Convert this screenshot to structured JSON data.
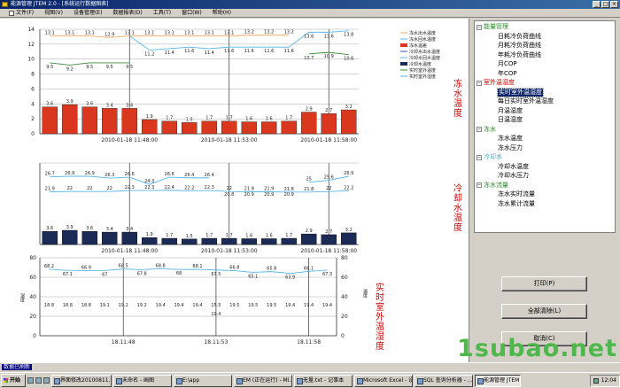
{
  "window": {
    "title": "能源管理 JTEM 2.0 - [系统运行数据图表]",
    "min": "_",
    "max": "□",
    "close": "×"
  },
  "menu": [
    "文件(F)",
    "视图(V)",
    "设备管理(E)",
    "数据报表(D)",
    "工具(T)",
    "窗口(W)",
    "帮助(H)"
  ],
  "colors": {
    "bar_red": "#d9381e",
    "bar_navy": "#1c2b55",
    "line_cyan": "#58b6e8",
    "line_orange": "#f0a860",
    "line_green": "#3a8a3a",
    "line_blue": "#3060b0",
    "side_red": "#cc0000",
    "side_green": "#2a8a2a",
    "side_cyan": "#40b0c0"
  },
  "chart_data": [
    {
      "type": "bar",
      "title": "冻水温度",
      "ylim": [
        0,
        14
      ],
      "yticks": [
        0,
        2,
        4,
        6,
        8,
        10,
        12,
        14
      ],
      "x_labels": [
        "2010-01-18 11:48:00",
        "2010-01-18 11:53:00",
        "2010-01-18 11:58:00"
      ],
      "values": [
        3.6,
        3.9,
        3.6,
        3.4,
        3.4,
        1.9,
        1.7,
        1.5,
        1.7,
        1.7,
        1.6,
        1.6,
        1.7,
        2.9,
        2.7,
        3.2
      ],
      "series": [
        {
          "name": "冻水出水温度",
          "values": [
            13.1,
            13.1,
            13.1,
            12.9,
            13.1,
            13.1,
            13.1,
            13.1,
            13.1,
            13.1,
            13.2,
            13.2,
            13.2,
            null,
            null,
            null
          ]
        },
        {
          "name": "冻水回水温度",
          "values": [
            null,
            null,
            null,
            null,
            13.1,
            11.2,
            11.4,
            11.6,
            11.4,
            11.6,
            11.6,
            11.6,
            11.6,
            13.6,
            13.6,
            13.8
          ]
        },
        {
          "name": "冻水温差",
          "values": [
            3.6,
            3.9,
            3.6,
            3.4,
            3.4,
            1.9,
            1.7,
            1.5,
            1.7,
            1.7,
            1.6,
            1.6,
            1.7,
            2.9,
            2.7,
            3.2
          ]
        },
        {
          "name": "冷却水出水温度",
          "values": []
        },
        {
          "name": "冷却水回水温度",
          "values": []
        },
        {
          "name": "冷却水温度",
          "values": []
        },
        {
          "name": "实时室外温度",
          "values": [
            9.5,
            9.2,
            9.5,
            9.5,
            9.5,
            null,
            null,
            null,
            null,
            null,
            null,
            null,
            null,
            10.7,
            10.9,
            10.6
          ]
        },
        {
          "name": "实时室外湿度",
          "values": []
        }
      ]
    },
    {
      "type": "bar",
      "title": "冷却水温度",
      "x_labels": [
        "2010-01-18 11:48:00",
        "2010-01-18 11:53:00",
        "2010-01-18 11:58:00"
      ],
      "values": [
        3.6,
        3.9,
        3.6,
        3.4,
        3.4,
        1.9,
        1.7,
        1.5,
        1.7,
        1.7,
        1.6,
        1.6,
        1.7,
        2.9,
        2.7,
        3.2
      ],
      "series": [
        {
          "name": "冷却水回水温度",
          "values": [
            26.7,
            26.9,
            26.9,
            26.3,
            26.6,
            24.3,
            26.6,
            26.4,
            26.4,
            null,
            null,
            null,
            null,
            25,
            25.6,
            26.9
          ]
        },
        {
          "name": "冷却水出水温度",
          "values": [
            21.9,
            22,
            22,
            22,
            22.3,
            22.3,
            22.4,
            22.2,
            22.3,
            22,
            21.9,
            21.9,
            21.8,
            21.8,
            22,
            22.2
          ]
        },
        {
          "name": "冷却水温差",
          "values": [
            null,
            null,
            null,
            null,
            null,
            null,
            null,
            null,
            null,
            20.8,
            20.9,
            20.9,
            20.9,
            null,
            null,
            null
          ]
        }
      ]
    },
    {
      "type": "line",
      "title": "实时室外温湿度",
      "ylabel_left": "湿度",
      "ylabel_right": "温度",
      "ylim": [
        0,
        80
      ],
      "yticks": [
        0,
        20,
        40,
        60,
        80
      ],
      "x_labels": [
        "18.11:48",
        "18.11:53",
        "18.11:58"
      ],
      "series": [
        {
          "name": "湿度",
          "values": [
            68.2,
            67.1,
            66.9,
            67,
            68.5,
            67.8,
            68.8,
            68,
            68.1,
            67.5,
            66.8,
            65.1,
            65.8,
            63.9,
            66.1,
            67.3
          ]
        },
        {
          "name": "温度",
          "values": [
            18.8,
            18.8,
            18.8,
            19.1,
            19.2,
            19.2,
            19.4,
            19.4,
            19.4,
            15.5,
            19.5,
            19.5,
            19.5,
            19.4,
            19.4,
            19.4
          ]
        }
      ],
      "annotations": [
        "19.4"
      ]
    }
  ],
  "sidebar": {
    "groups": [
      {
        "label": "能量管理",
        "color": "#2a8a2a",
        "expander": "−",
        "items": [
          "日耗冷负荷曲线",
          "月耗冷负荷曲线",
          "年耗冷负荷曲线",
          "月COP",
          "年COP"
        ]
      },
      {
        "label": "室外温湿度",
        "color": "#cc0000",
        "expander": "−",
        "items": [
          "实时室外温湿度",
          "每日实时室外温湿度",
          "月温湿度",
          "日温湿度"
        ]
      },
      {
        "label": "冻水",
        "color": "#2a8a2a",
        "expander": "−",
        "items": [
          "冻水温度",
          "冻水压力"
        ]
      },
      {
        "label": "冷却水",
        "color": "#40b0c0",
        "expander": "−",
        "items": [
          "冷却水温度",
          "冷却水压力"
        ]
      },
      {
        "label": "冻水流量",
        "color": "#2a8a2a",
        "expander": "−",
        "items": [
          "冻水实时流量",
          "冻水累计流量"
        ]
      }
    ],
    "buttons": {
      "print": "打印(P)",
      "clear_all": "全部清除(L)",
      "cancel": "取消(C)"
    }
  },
  "watermark": "1subao.net",
  "statusbar": {
    "text": "数据已刷新"
  },
  "taskbar": {
    "start": "开始",
    "tasks": [
      "界面修改20100811...",
      "未命名 - 画图",
      "E:\\app",
      "EM (正在运行) - Mi...",
      "无量.txt - 记事本",
      "Microsoft Excel - 设...",
      "SQL 查询分析器 - ...",
      "能源管理 JTEM 2..."
    ],
    "clock": "12:04"
  }
}
